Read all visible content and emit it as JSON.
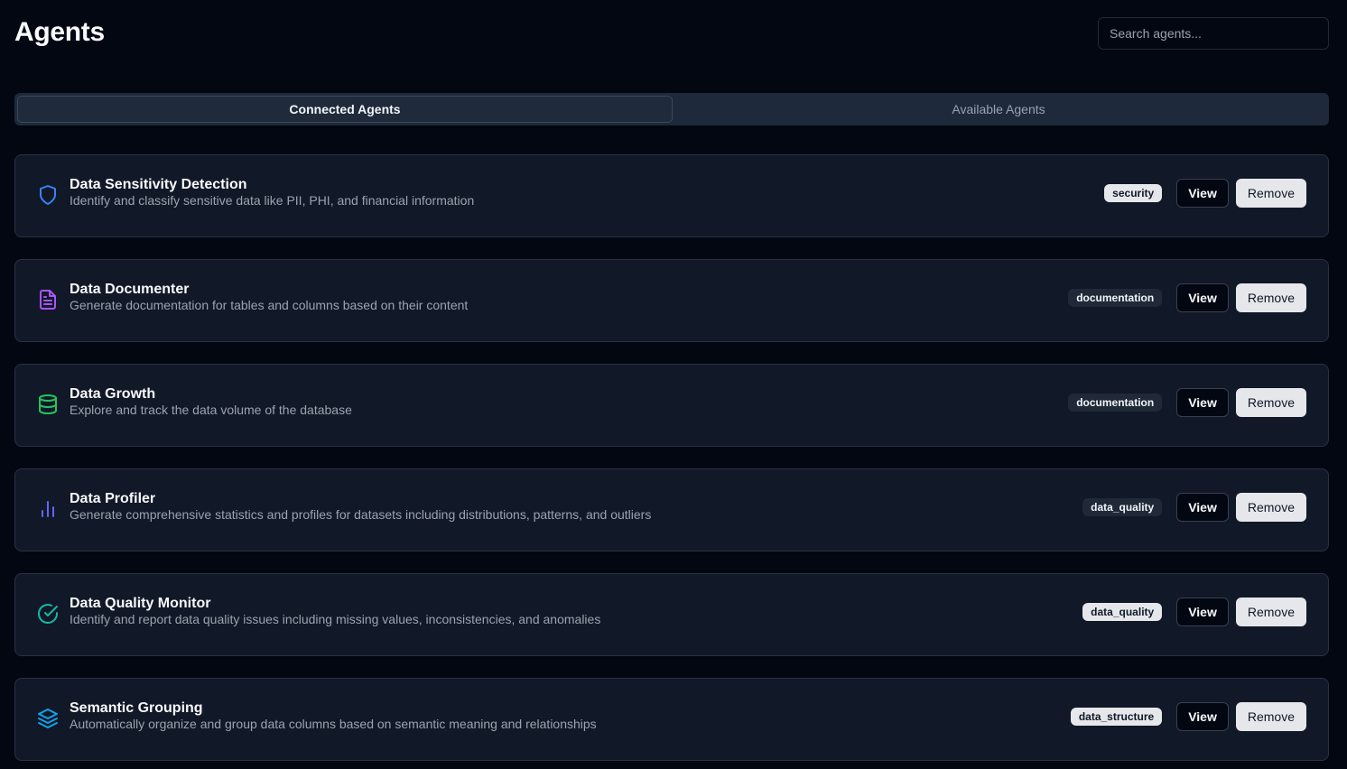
{
  "page": {
    "title": "Agents"
  },
  "search": {
    "placeholder": "Search agents..."
  },
  "tabs": [
    {
      "label": "Connected Agents",
      "active": true
    },
    {
      "label": "Available Agents",
      "active": false
    }
  ],
  "agents": [
    {
      "title": "Data Sensitivity Detection",
      "description": "Identify and classify sensitive data like PII, PHI, and financial information",
      "tag": "security",
      "tag_style": "light",
      "icon": "shield-icon",
      "icon_color": "#3b82f6",
      "view_label": "View",
      "remove_label": "Remove"
    },
    {
      "title": "Data Documenter",
      "description": "Generate documentation for tables and columns based on their content",
      "tag": "documentation",
      "tag_style": "dark",
      "icon": "document-icon",
      "icon_color": "#a855f7",
      "view_label": "View",
      "remove_label": "Remove"
    },
    {
      "title": "Data Growth",
      "description": "Explore and track the data volume of the database",
      "tag": "documentation",
      "tag_style": "dark",
      "icon": "database-icon",
      "icon_color": "#22c55e",
      "view_label": "View",
      "remove_label": "Remove"
    },
    {
      "title": "Data Profiler",
      "description": "Generate comprehensive statistics and profiles for datasets including distributions, patterns, and outliers",
      "tag": "data_quality",
      "tag_style": "dark",
      "icon": "bar-chart-icon",
      "icon_color": "#6366f1",
      "view_label": "View",
      "remove_label": "Remove"
    },
    {
      "title": "Data Quality Monitor",
      "description": "Identify and report data quality issues including missing values, inconsistencies, and anomalies",
      "tag": "data_quality",
      "tag_style": "light",
      "icon": "check-circle-icon",
      "icon_color": "#14b8a6",
      "view_label": "View",
      "remove_label": "Remove"
    },
    {
      "title": "Semantic Grouping",
      "description": "Automatically organize and group data columns based on semantic meaning and relationships",
      "tag": "data_structure",
      "tag_style": "light",
      "icon": "layers-icon",
      "icon_color": "#0ea5e9",
      "view_label": "View",
      "remove_label": "Remove"
    }
  ]
}
